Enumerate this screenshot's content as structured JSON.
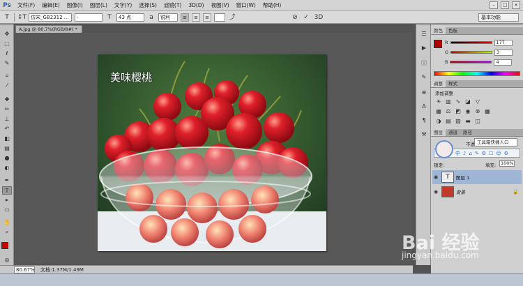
{
  "app": {
    "logo": "Ps"
  },
  "menubar": {
    "items": [
      "文件(F)",
      "编辑(E)",
      "图像(I)",
      "图层(L)",
      "文字(Y)",
      "选择(S)",
      "滤镜(T)",
      "3D(D)",
      "视图(V)",
      "窗口(W)",
      "帮助(H)"
    ],
    "window_controls": [
      "–",
      "□",
      "×"
    ]
  },
  "options": {
    "tool_icon": "T",
    "orient_icon": "↕T",
    "font_family": "仿宋_GB2312 ...",
    "font_style": "-",
    "size_icon": "T",
    "font_size": "43 点",
    "aa_icon": "a",
    "anti_alias": "锐利",
    "align": [
      "≡",
      "≡",
      "≡"
    ],
    "warp_icon": "⤴",
    "cancel_icon": "⊘",
    "commit_icon": "✓",
    "threed_label": "3D",
    "workspace": "基本功能"
  },
  "document": {
    "tab_title": "A.jpg @ 80.7%(RGB/8#) * ",
    "overlay_text": "美味樱桃"
  },
  "status": {
    "zoom": "80.67%",
    "doc_info": "文档:1.37M/1.49M"
  },
  "color_panel": {
    "tabs": [
      "颜色",
      "色板"
    ],
    "rows": [
      {
        "label": "R",
        "value": "177"
      },
      {
        "label": "G",
        "value": "3"
      },
      {
        "label": "B",
        "value": "4"
      }
    ],
    "fg_color": "#b10304"
  },
  "adjust_panel": {
    "tabs": [
      "调整",
      "样式"
    ],
    "title": "添加调整"
  },
  "layers_panel": {
    "tabs": [
      "图层",
      "通道",
      "路径"
    ],
    "quick_tooltip": "工具箱快捷入口",
    "quick_icons": [
      "中",
      "♪",
      "⌂",
      "✎",
      "⚙",
      "☐",
      "☺",
      "⚙"
    ],
    "opacity_label": "不透明度",
    "lock_label": "锁定:",
    "fill_label": "填充:",
    "fill_value": "100%",
    "layers": [
      {
        "name": "图层 1",
        "thumb": "T",
        "selected": true
      },
      {
        "name": "背景",
        "thumb": "",
        "selected": false
      }
    ]
  },
  "watermark": {
    "text": "Bai 经验",
    "url": "jingyan.baidu.com"
  }
}
